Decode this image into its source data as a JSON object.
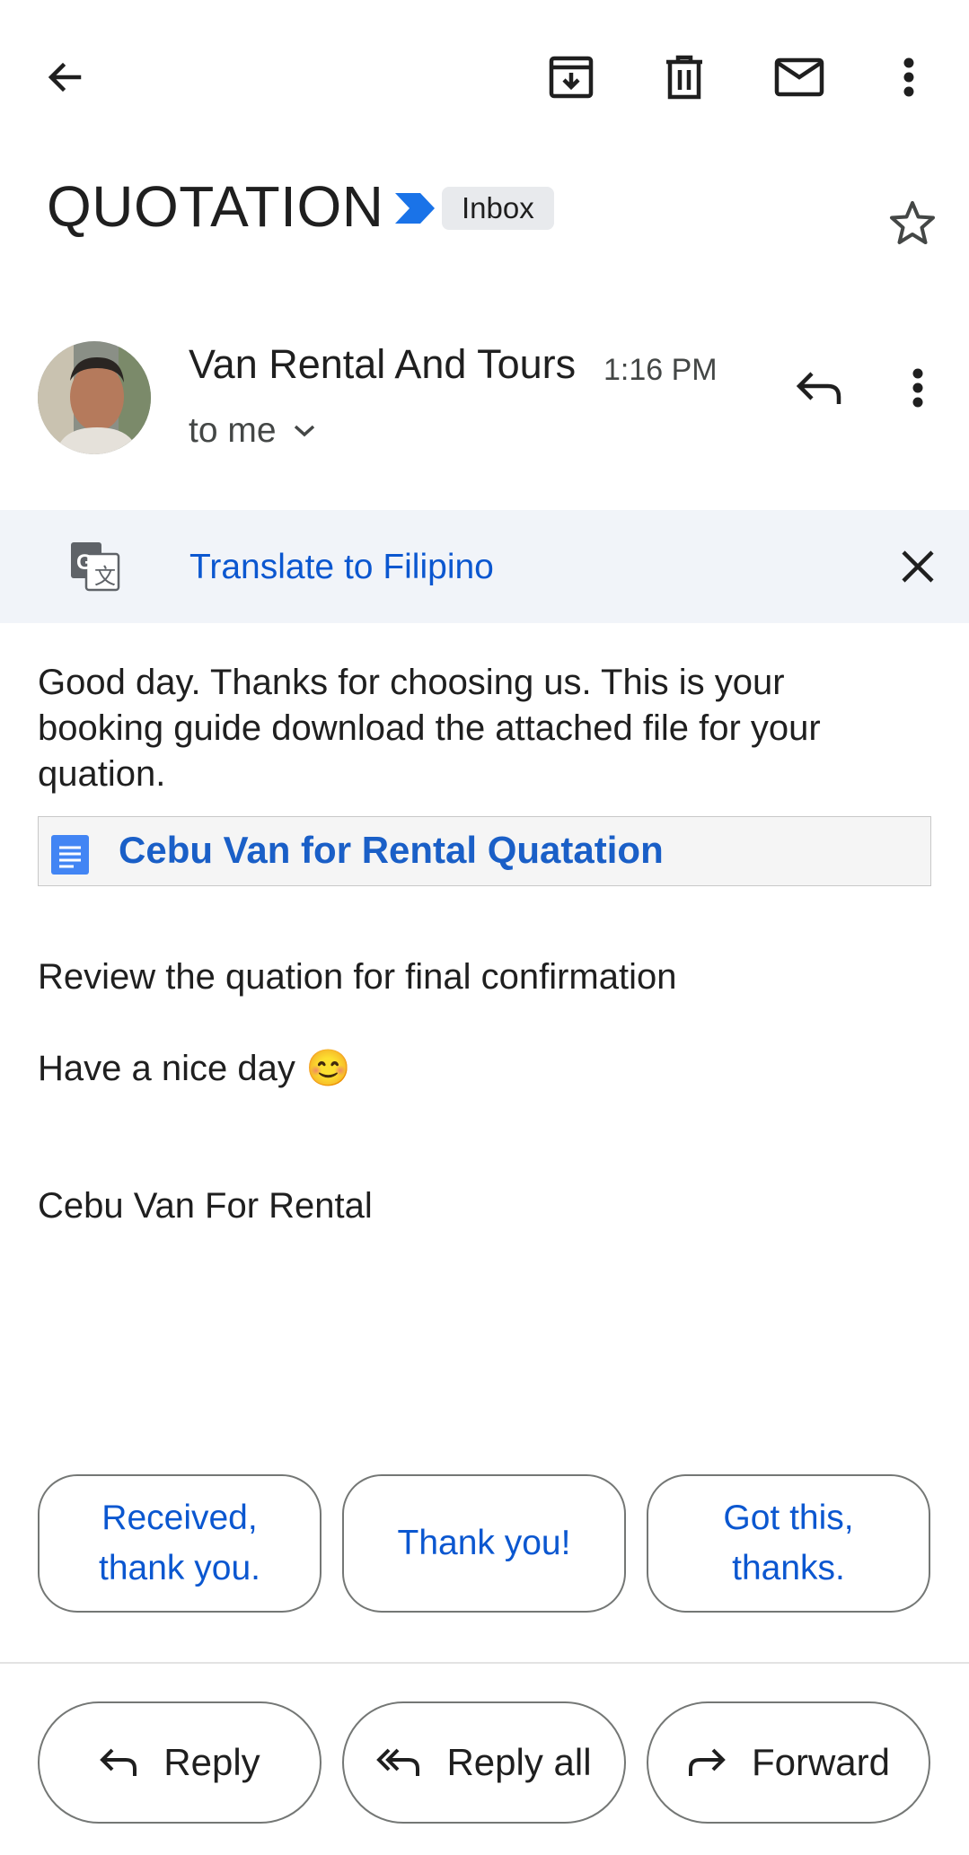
{
  "toolbar": {
    "back_icon": "arrow-back-icon",
    "archive_icon": "archive-icon",
    "delete_icon": "trash-icon",
    "mark_unread_icon": "mail-icon",
    "more_icon": "more-vert-icon"
  },
  "subject": "QUOTATION",
  "label": "Inbox",
  "sender": {
    "name": "Van Rental And Tours",
    "time": "1:16 PM",
    "recipient": "to me"
  },
  "translate": {
    "link": "Translate to Filipino"
  },
  "body": {
    "line1": "Good day. Thanks for choosing us. This is your",
    "line2": "booking guide download the attached file for your",
    "line3": "quation.",
    "attachment_title": "Cebu Van for Rental Quatation",
    "review": "Review the quation for final confirmation",
    "closing": "Have a nice day",
    "emoji": "😊",
    "signature": "Cebu Van For Rental"
  },
  "smart_replies": [
    "Received,\nthank you.",
    "Thank you!",
    "Got this,\nthanks."
  ],
  "actions": {
    "reply": "Reply",
    "reply_all": "Reply all",
    "forward": "Forward"
  },
  "colors": {
    "link_blue": "#0b57d0",
    "translate_bg": "#f1f4f9",
    "label_chip_bg": "#e8eaed"
  }
}
